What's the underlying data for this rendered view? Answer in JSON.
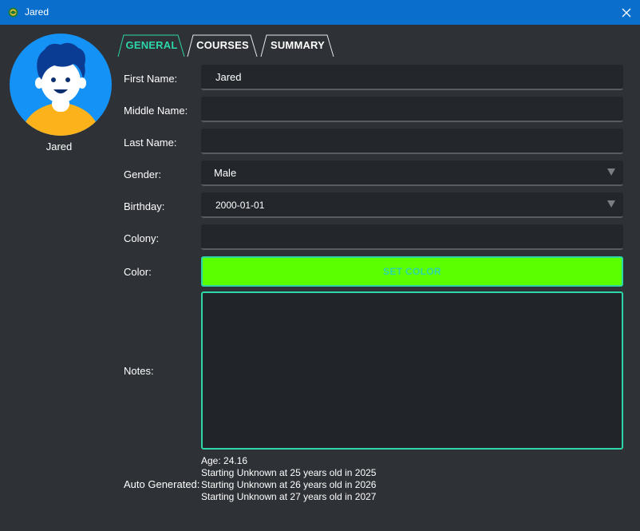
{
  "window": {
    "title": "Jared",
    "icon": "app-globe-icon",
    "close_icon": "close-icon"
  },
  "profile": {
    "name": "Jared",
    "avatar": "avatar-icon"
  },
  "tabs": [
    {
      "label": "GENERAL",
      "active": true
    },
    {
      "label": "COURSES",
      "active": false
    },
    {
      "label": "SUMMARY",
      "active": false
    }
  ],
  "form": {
    "first_name": {
      "label": "First Name:",
      "value": "Jared"
    },
    "middle_name": {
      "label": "Middle Name:",
      "value": ""
    },
    "last_name": {
      "label": "Last Name:",
      "value": ""
    },
    "gender": {
      "label": "Gender:",
      "value": "Male"
    },
    "birthday": {
      "label": "Birthday:",
      "value": "2000-01-01"
    },
    "colony": {
      "label": "Colony:",
      "value": ""
    },
    "color": {
      "label": "Color:",
      "button_label": "SET COLOR",
      "swatch": "#5cff00"
    },
    "notes": {
      "label": "Notes:",
      "value": ""
    },
    "auto_generated": {
      "label": "Auto Generated:",
      "lines": [
        "Age: 24.16",
        "Starting Unknown at 25 years old in 2025",
        "Starting Unknown at 26 years old in 2026",
        "Starting Unknown at 27 years old in 2027"
      ]
    }
  },
  "colors": {
    "accent": "#2cd6a8",
    "titlebar": "#0a6fcc",
    "background": "#2e3136",
    "field": "#23262b"
  }
}
